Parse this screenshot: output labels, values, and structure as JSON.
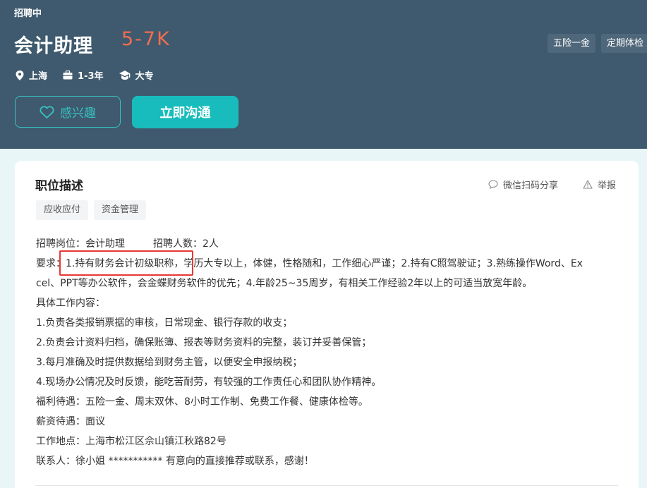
{
  "header": {
    "status": "招聘中",
    "job_title": "会计助理",
    "salary": "5-7K",
    "meta": [
      {
        "icon": "location-icon",
        "label": "上海"
      },
      {
        "icon": "briefcase-icon",
        "label": "1-3年"
      },
      {
        "icon": "graduation-cap-icon",
        "label": "大专"
      }
    ],
    "benefit_tags": [
      "五险一金",
      "定期体检"
    ],
    "interest_label": "感兴趣",
    "chat_label": "立即沟通"
  },
  "card": {
    "title": "职位描述",
    "share_label": "微信扫码分享",
    "report_label": "举报",
    "skill_tags": [
      "应收应付",
      "资金管理"
    ],
    "recruit_position": "招聘岗位：会计助理",
    "recruit_count": "招聘人数：2人",
    "lines": [
      "要求：1.持有财务会计初级职称，学历大专以上，体健，性格随和，工作细心严谨；2.持有C照驾驶证；3.熟练操作Word、Ex",
      "cel、PPT等办公软件，会金蝶财务软件的优先；4.年龄25~35周岁，有相关工作经验2年以上的可适当放宽年龄。",
      "具体工作内容：",
      "1.负责各类报销票据的审核，日常现金、银行存款的收支；",
      "2.负责会计资料归档，确保账簿、报表等财务资料的完整，装订并妥善保管；",
      "3.每月准确及时提供数据给到财务主管，以便安全申报纳税；",
      "4.现场办公情况及时反馈，能吃苦耐劳，有较强的工作责任心和团队协作精神。",
      "福利待遇：五险一金、周末双休、8小时工作制、免费工作餐、健康体检等。",
      "薪资待遇：面议",
      "工作地点：上海市松江区佘山镇江秋路82号",
      "联系人：徐小姐 *********** 有意向的直接推荐或联系，感谢！"
    ]
  },
  "colors": {
    "banner": "#3f5a6e",
    "accent": "#18bcbc",
    "salary": "#f26d4f",
    "highlight": "#e53935"
  }
}
